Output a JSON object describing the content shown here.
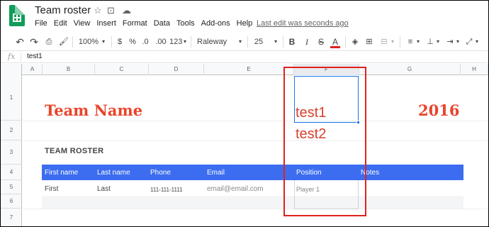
{
  "app": {
    "title": "Team roster",
    "last_edit": "Last edit was seconds ago"
  },
  "menu": [
    "File",
    "Edit",
    "View",
    "Insert",
    "Format",
    "Data",
    "Tools",
    "Add-ons",
    "Help"
  ],
  "toolbar": {
    "zoom": "100%",
    "currency": "$",
    "percent": "%",
    "dec_decrease": ".0",
    "dec_increase": ".00",
    "more_formats": "123",
    "font": "Raleway",
    "font_size": "25",
    "bold": "B",
    "italic": "I",
    "strike": "S",
    "text_color": "A"
  },
  "formula_bar": {
    "fx": "fx",
    "value": "test1"
  },
  "columns": [
    "A",
    "B",
    "C",
    "D",
    "E",
    "F",
    "G",
    "H"
  ],
  "rows": [
    "1",
    "2",
    "3",
    "4",
    "5",
    "6",
    "7"
  ],
  "sheet": {
    "team_name": "Team Name",
    "year": "2016",
    "roster_heading": "TEAM ROSTER",
    "headers": [
      "First name",
      "Last name",
      "Phone",
      "Email",
      "Position",
      "Notes"
    ],
    "row5": {
      "first": "First",
      "last": "Last",
      "phone": "111-111-1111",
      "email": "email@email.com",
      "position": "Player 1"
    },
    "test1": "test1",
    "test2": "test2"
  },
  "colors": {
    "accent_red": "#e8452c",
    "header_band": "#3c6df0",
    "selection": "#1a73e8",
    "highlight_outline": "#e0221e"
  }
}
